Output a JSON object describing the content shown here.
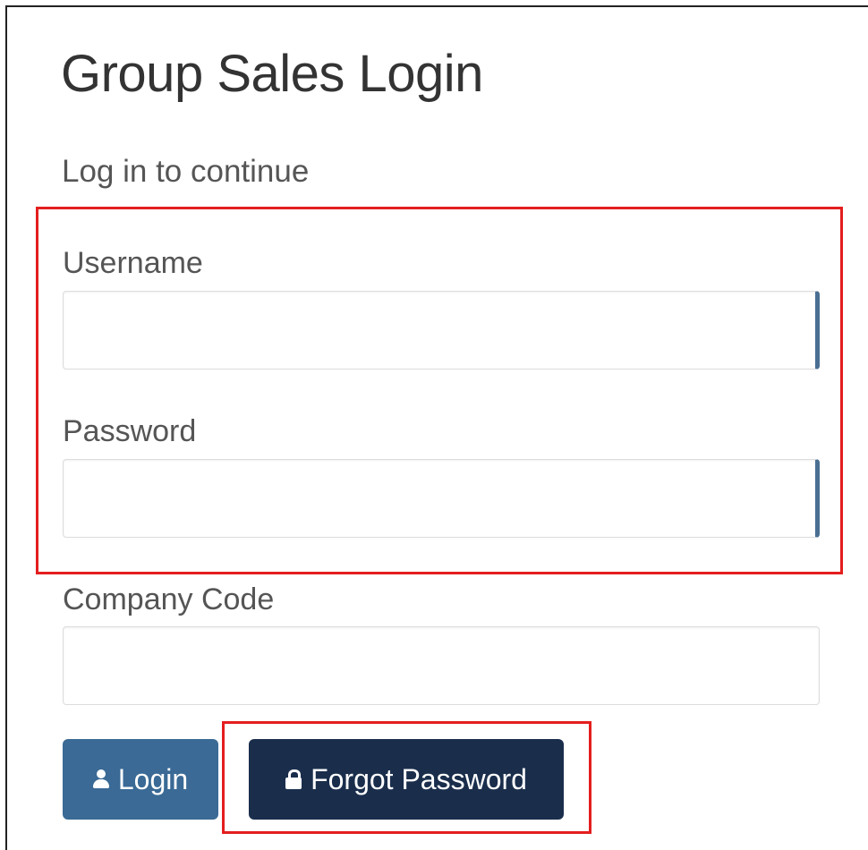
{
  "page": {
    "title": "Group Sales Login",
    "subtitle": "Log in to continue"
  },
  "form": {
    "username": {
      "label": "Username",
      "value": "",
      "placeholder": ""
    },
    "password": {
      "label": "Password",
      "value": "",
      "placeholder": ""
    },
    "company_code": {
      "label": "Company Code",
      "value": "",
      "placeholder": ""
    }
  },
  "buttons": {
    "login": {
      "label": "Login",
      "icon": "user-icon"
    },
    "forgot_password": {
      "label": "Forgot Password",
      "icon": "lock-icon"
    }
  },
  "colors": {
    "login_button": "#3a6a95",
    "forgot_button": "#1a2e4c",
    "annotation": "#e41e1e"
  }
}
